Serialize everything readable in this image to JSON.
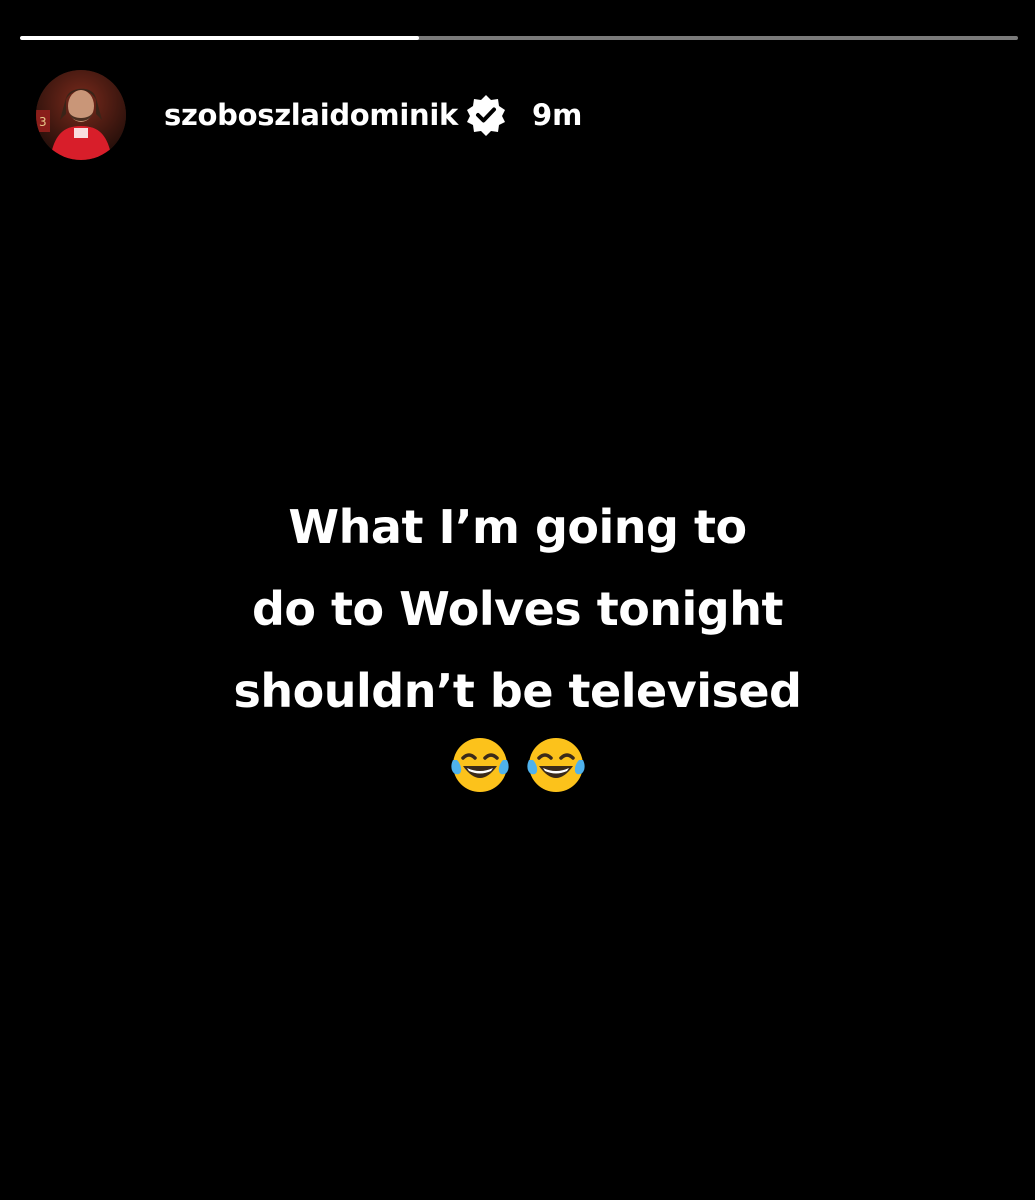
{
  "story": {
    "progress_fraction": 0.4,
    "username": "szoboszlaidominik",
    "verified": true,
    "time": "9m",
    "text_lines": [
      "What I’m going to",
      "do to Wolves tonight",
      "shouldn’t be televised"
    ],
    "emoji_line": "😂😂"
  },
  "colors": {
    "background": "#000000",
    "text": "#ffffff",
    "progress_track": "#7a7a7a",
    "progress_fill": "#ffffff"
  },
  "icons": {
    "verified": "verified-badge-icon",
    "emoji": "face-with-tears-of-joy"
  }
}
